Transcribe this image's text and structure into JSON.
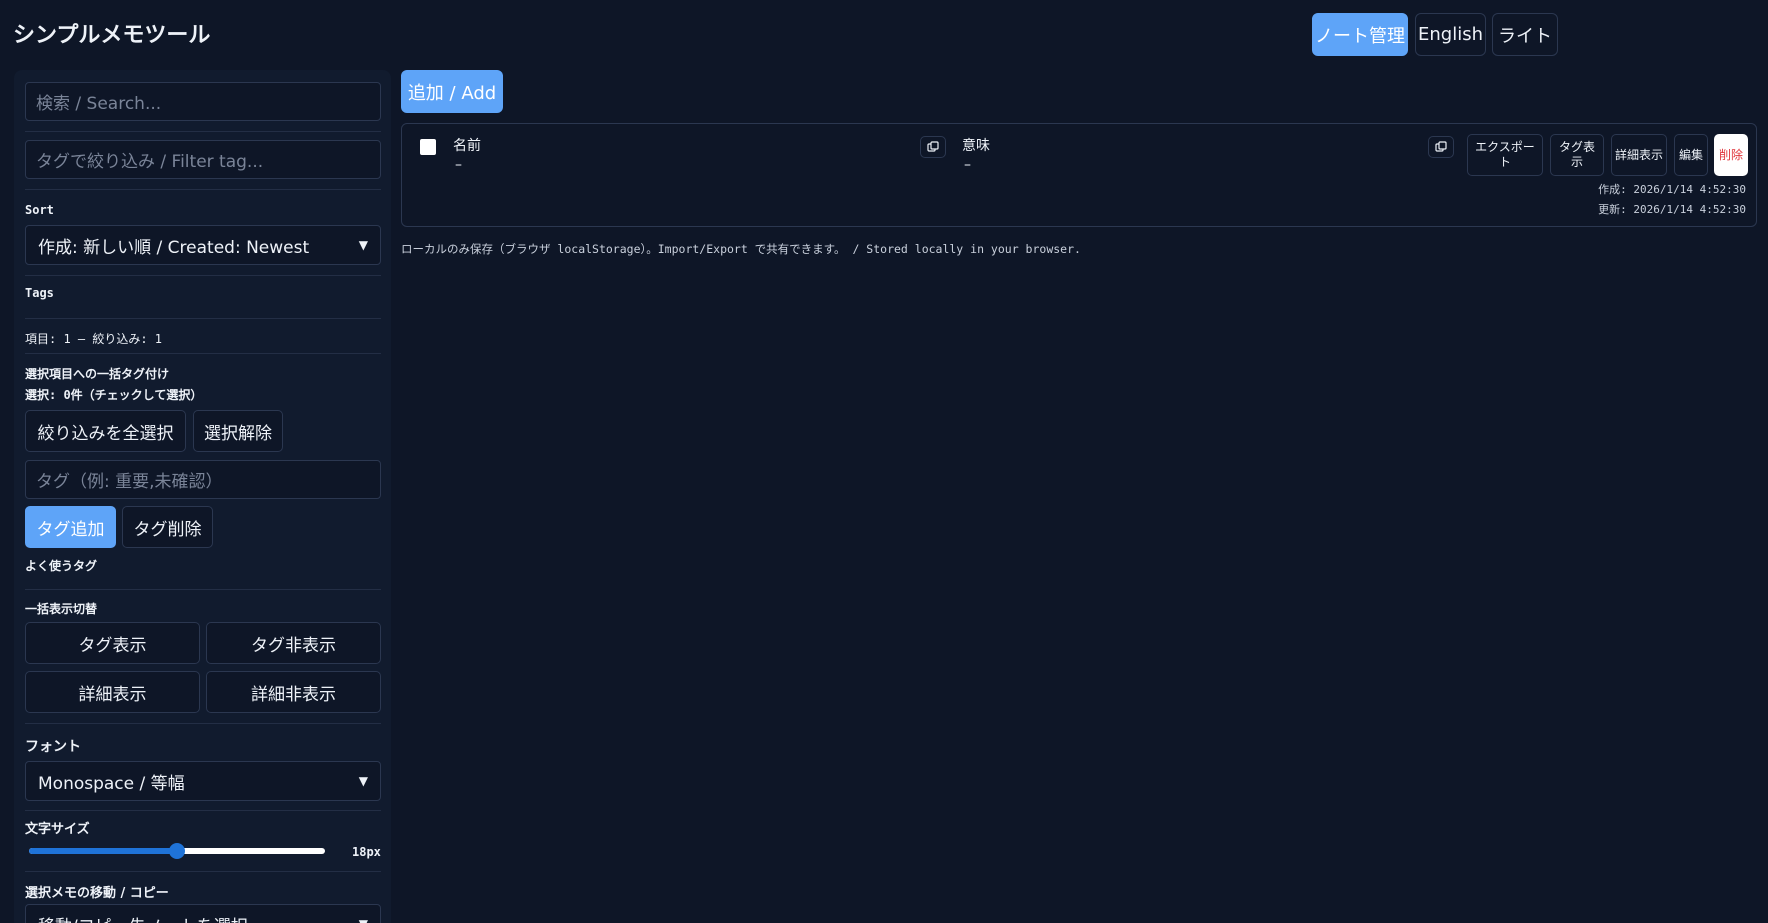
{
  "header": {
    "title": "シンプルメモツール",
    "notes_button": "ノート管理",
    "language_button": "English",
    "theme_button": "ライト"
  },
  "sidebar": {
    "search_placeholder": "検索 / Search...",
    "filter_tag_placeholder": "タグで絞り込み / Filter tag...",
    "sort_label": "Sort",
    "sort_value": "作成: 新しい順 / Created: Newest",
    "tags_label": "Tags",
    "counts": "項目: 1 — 絞り込み: 1",
    "bulk_tag_title": "選択項目への一括タグ付け",
    "selection_status": "選択: 0件（チェックして選択）",
    "select_all_filtered": "絞り込みを全選択",
    "clear_selection": "選択解除",
    "tag_input_placeholder": "タグ（例: 重要,未確認）",
    "add_tag": "タグ追加",
    "remove_tag": "タグ削除",
    "frequent_tags_label": "よく使うタグ",
    "bulk_display_label": "一括表示切替",
    "show_tags": "タグ表示",
    "hide_tags": "タグ非表示",
    "show_details": "詳細表示",
    "hide_details": "詳細非表示",
    "font_label": "フォント",
    "font_value": "Monospace / 等幅",
    "font_size_label": "文字サイズ",
    "font_size_value": "18px",
    "font_size_fraction": 0.5,
    "move_copy_label": "選択メモの移動 / コピー",
    "move_copy_select": "移動/コピー先ノートを選択"
  },
  "main": {
    "add_button": "追加 / Add",
    "card": {
      "name_label": "名前",
      "name_value": "–",
      "meaning_label": "意味",
      "meaning_value": "–",
      "export_button": "エクスポート",
      "show_tags_button": "タグ表示",
      "details_button": "詳細表示",
      "edit_button": "編集",
      "delete_button": "削除",
      "created": "作成: 2026/1/14 4:52:30",
      "updated": "更新: 2026/1/14 4:52:30"
    },
    "footer_note": "ローカルのみ保存（ブラウザ localStorage）。Import/Export で共有できます。 / Stored locally in your browser."
  },
  "colors": {
    "background": "#0e1627",
    "accent": "#5ea4f8",
    "danger": "#e0343a"
  }
}
